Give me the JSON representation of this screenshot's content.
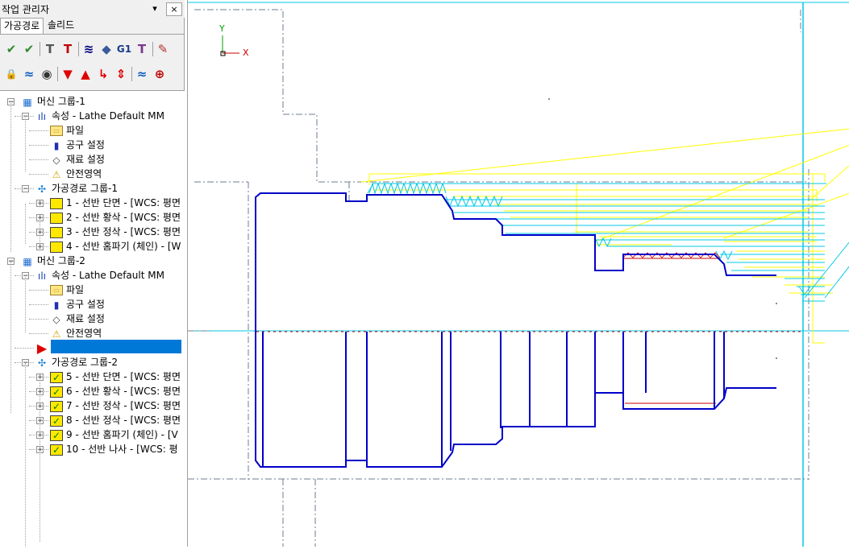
{
  "panel": {
    "title": "작업 관리자",
    "pin_glyph": "▾",
    "close_glyph": "×",
    "tabs": [
      {
        "label": "가공경로"
      },
      {
        "label": "솔리드"
      }
    ]
  },
  "toolbar1": [
    {
      "name": "select-all-ops-icon",
      "glyph": "✔",
      "color": "#2e8b2e"
    },
    {
      "name": "select-dirty-ops-icon",
      "glyph": "✔",
      "color": "#2e8b2e"
    },
    {
      "name": "regen-selected-icon",
      "glyph": "T",
      "color": "#555555"
    },
    {
      "name": "regen-dirty-icon",
      "glyph": "T",
      "color": "#c00000"
    },
    {
      "name": "backplot-icon",
      "glyph": "≋",
      "color": "#000080"
    },
    {
      "name": "verify-icon",
      "glyph": "◆",
      "color": "#3a5a9a"
    },
    {
      "name": "post-g1-icon",
      "glyph": "G1",
      "color": "#1a3a8a"
    },
    {
      "name": "post-output-icon",
      "glyph": "T",
      "color": "#7a3a8a"
    },
    {
      "name": "highfeed-icon",
      "glyph": "✎",
      "color": "#b03030"
    }
  ],
  "toolbar2": [
    {
      "name": "lock-icon",
      "glyph": "🔒",
      "color": "#c8a000"
    },
    {
      "name": "toggle-display-icon",
      "glyph": "≈",
      "color": "#1060c0"
    },
    {
      "name": "toggle-posting-icon",
      "glyph": "◉",
      "color": "#333333"
    },
    {
      "name": "move-down-icon",
      "glyph": "▼",
      "color": "#e00000"
    },
    {
      "name": "move-up-icon",
      "glyph": "▲",
      "color": "#e00000"
    },
    {
      "name": "insert-arrow-icon",
      "glyph": "↳",
      "color": "#e00000"
    },
    {
      "name": "scroll-icon",
      "glyph": "⇕",
      "color": "#e00000"
    },
    {
      "name": "show-toolpath-icon",
      "glyph": "≈",
      "color": "#1060c0"
    },
    {
      "name": "display-toggle-icon",
      "glyph": "⊕",
      "color": "#c00000"
    }
  ],
  "tree": [
    {
      "label": "머신 그룹-1",
      "icon": "machine-group-icon",
      "level": 0
    },
    {
      "label": "속성 - Lathe Default MM",
      "icon": "properties-icon",
      "level": 1
    },
    {
      "label": "파일",
      "icon": "folder-icon",
      "level": 2
    },
    {
      "label": "공구 설정",
      "icon": "tool-settings-icon",
      "level": 2
    },
    {
      "label": "재료 설정",
      "icon": "stock-setup-icon",
      "level": 2
    },
    {
      "label": "안전영역",
      "icon": "safety-zone-icon",
      "level": 2
    },
    {
      "label": "가공경로 그룹-1",
      "icon": "toolpath-group-icon",
      "level": 1
    },
    {
      "label": "1 - 선반 단면 - [WCS: 평면",
      "icon": "operation-folder-icon",
      "level": 2
    },
    {
      "label": "2 - 선반 황삭 - [WCS: 평면",
      "icon": "operation-folder-icon",
      "level": 2
    },
    {
      "label": "3 - 선반 정삭 - [WCS: 평면",
      "icon": "operation-folder-icon",
      "level": 2
    },
    {
      "label": "4 - 선반 홈파기 (체인) - [W",
      "icon": "operation-folder-icon",
      "level": 2
    },
    {
      "label": "머신 그룹-2",
      "icon": "machine-group-icon",
      "level": 0
    },
    {
      "label": "속성 - Lathe Default MM",
      "icon": "properties-icon",
      "level": 1
    },
    {
      "label": "파일",
      "icon": "folder-icon",
      "level": 2
    },
    {
      "label": "공구 설정",
      "icon": "tool-settings-icon",
      "level": 2
    },
    {
      "label": "재료 설정",
      "icon": "stock-setup-icon",
      "level": 2
    },
    {
      "label": "안전영역",
      "icon": "safety-zone-icon",
      "level": 2
    },
    {
      "label": "",
      "icon": "insert-arrow-icon",
      "level": 1
    },
    {
      "label": "가공경로 그룹-2",
      "icon": "toolpath-group-icon",
      "level": 1
    },
    {
      "label": "5 - 선반 단면 - [WCS: 평면",
      "icon": "operation-checked-icon",
      "level": 2
    },
    {
      "label": "6 - 선반 황삭 - [WCS: 평면",
      "icon": "operation-checked-icon",
      "level": 2
    },
    {
      "label": "7 - 선반 정삭 - [WCS: 평면",
      "icon": "operation-checked-icon",
      "level": 2
    },
    {
      "label": "8 - 선반 정삭 - [WCS: 평면",
      "icon": "operation-checked-icon",
      "level": 2
    },
    {
      "label": "9 - 선반 홈파기 (체인) - [V",
      "icon": "operation-checked-icon",
      "level": 2
    },
    {
      "label": "10 - 선반 나사 - [WCS: 평",
      "icon": "operation-checked-icon",
      "level": 2
    }
  ],
  "viewport": {
    "axis_y_label": "Y",
    "axis_x_label": "X",
    "colors": {
      "part": "#0000c8",
      "rough": "#ffff00",
      "finish": "#00c8e6",
      "centerline": "#c80000",
      "axis": "#00c8e6"
    }
  }
}
